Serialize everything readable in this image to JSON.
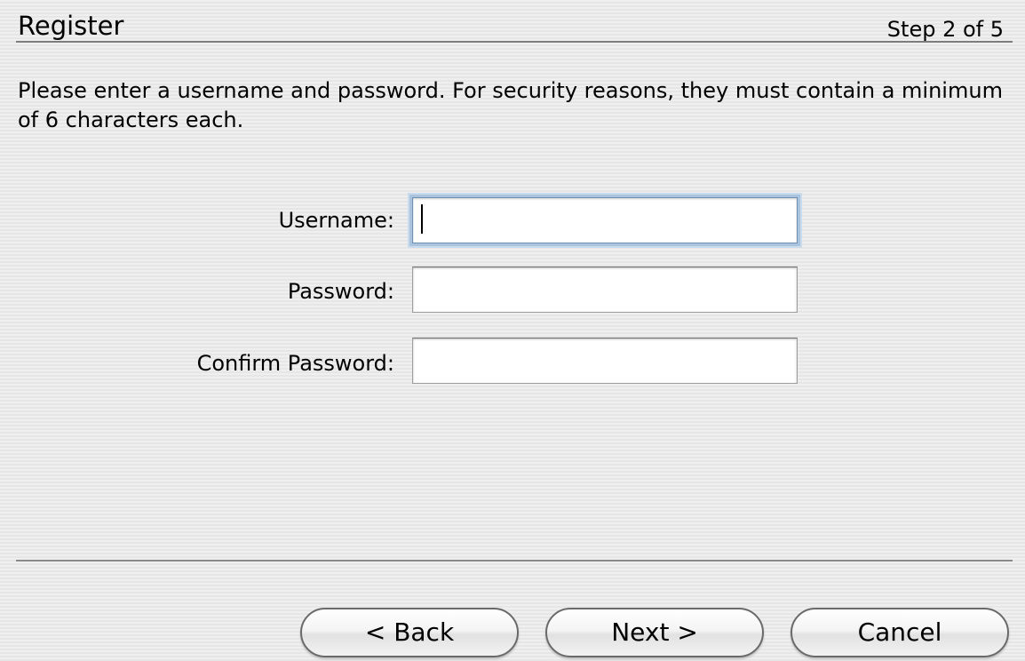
{
  "header": {
    "title": "Register",
    "step": "Step 2 of 5"
  },
  "instructions": "Please enter a username and password. For security reasons, they must contain a minimum of 6 characters each.",
  "form": {
    "username_label": "Username:",
    "username_value": "",
    "password_label": "Password:",
    "password_value": "",
    "confirm_label": "Confirm Password:",
    "confirm_value": ""
  },
  "buttons": {
    "back": "< Back",
    "next": "Next >",
    "cancel": "Cancel"
  }
}
